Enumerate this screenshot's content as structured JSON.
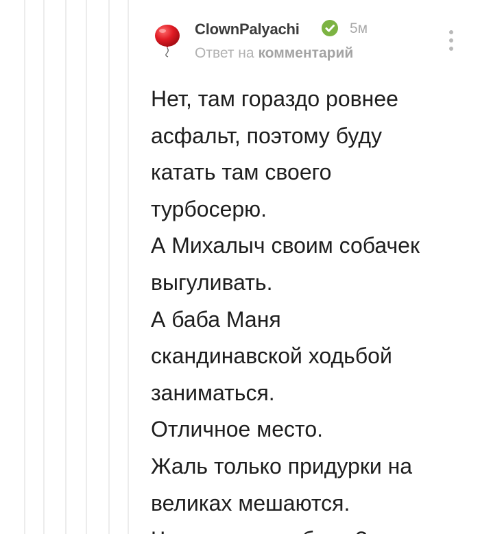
{
  "comment": {
    "author": "ClownPalyachi",
    "time": "5м",
    "reply_prefix": "Ответ на",
    "reply_link": "комментарий",
    "body_lines": [
      "Нет, там гораздо ровнее",
      "асфальт, поэтому буду",
      "катать там своего",
      "турбосерю.",
      "А Михалыч своим собачек",
      "выгуливать.",
      "А баба Маня",
      "скандинавской ходьбой",
      "заниматься.",
      "Отличное место.",
      "Жаль только придурки на",
      "великах мешаются.",
      "Что они там забыли?"
    ]
  },
  "icons": {
    "avatar": "red-balloon-icon",
    "verified": "verified-check-icon",
    "menu": "more-vertical-icon"
  },
  "colors": {
    "verified_green": "#7cb342",
    "balloon_red": "#e01b24",
    "thread_line": "#ececec"
  }
}
